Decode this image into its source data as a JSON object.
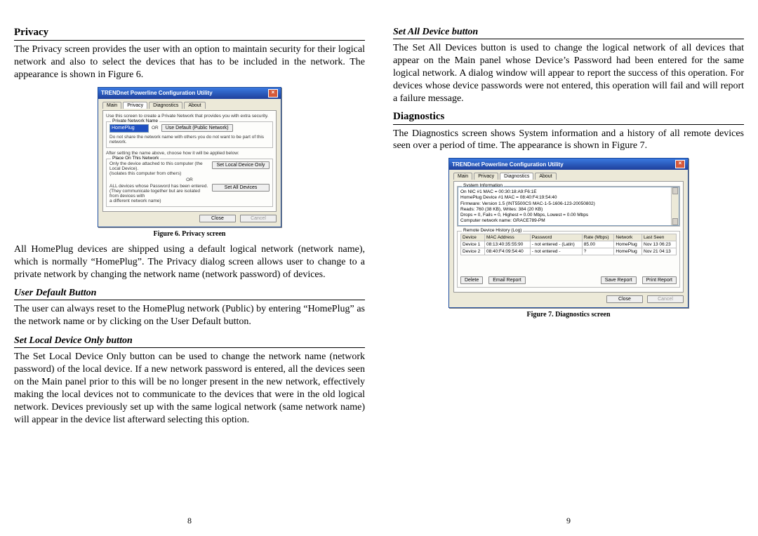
{
  "left": {
    "section_privacy_title": "Privacy",
    "privacy_p1": "The Privacy screen provides the user with an option to maintain security for their logical network and also to select the devices that has to be included in the network. The appearance is shown in Figure 6.",
    "fig6_caption": "Figure 6. Privacy screen",
    "privacy_p2": "All HomePlug devices are shipped using a default logical network (network name), which is normally “HomePlug”. The Privacy dialog screen allows user to change to a private network by changing the network name (network password) of devices.",
    "sub_user_default": "User Default Button",
    "user_default_p": "The user can always reset to the HomePlug network (Public) by entering “HomePlug” as the network name or by clicking on the User Default button.",
    "sub_set_local": "Set Local Device Only button",
    "set_local_p": "The Set Local Device Only button can be used to change the network name (network password) of the local device. If a new network password is entered, all the devices seen on the Main panel prior to this will be no longer present in the new network, effectively making the local devices not to communicate to the devices that were in the old logical network. Devices previously set up with the same logical network (same network name) will appear in the device list afterward selecting this option.",
    "page_number": "8"
  },
  "right": {
    "sub_set_all": "Set All Device button",
    "set_all_p": "The Set All Devices button is used to change the logical network of all devices that appear on the Main panel whose Device’s Password had been entered for the same logical network. A dialog window will appear to report the success of this operation. For devices whose device passwords were not entered, this operation will fail and will report a failure message.",
    "section_diag_title": "Diagnostics",
    "diag_p": "The Diagnostics screen shows System information and a history of all remote devices seen over a period of time. The appearance is shown in Figure 7.",
    "fig7_caption": "Figure 7. Diagnostics screen",
    "page_number": "9"
  },
  "privacy_window": {
    "title": "TRENDnet Powerline Configuration Utility",
    "tabs": [
      "Main",
      "Privacy",
      "Diagnostics",
      "About"
    ],
    "active_tab_index": 1,
    "intro": "Use this screen to create a Private Network that provides you with extra security.",
    "network_label": "Private Network Name",
    "network_value": "HomePlug",
    "or": "OR",
    "use_default_btn": "Use Default (Public Network)",
    "note1": "Do not share the network name with others you do not want to be part of this network.",
    "note2": "After setting the name above, choose how it will be applied below:",
    "fieldset_legend": "Place On This Network",
    "only_text": "Only the device attached to this computer (the Local Device).\n(Isolates this computer from others)",
    "set_local_btn": "Set Local Device Only",
    "all_text": "ALL devices whose Password has been entered.\n(They communicate together but are isolated from devices with\na different network name)",
    "set_all_btn": "Set All Devices",
    "close_btn": "Close",
    "cancel_btn": "Cancel"
  },
  "diag_window": {
    "title": "TRENDnet Powerline Configuration Utility",
    "tabs": [
      "Main",
      "Privacy",
      "Diagnostics",
      "About"
    ],
    "active_tab_index": 2,
    "sysinfo_legend": "System Information",
    "sysinfo_lines": [
      "On NIC #1 MAC = 00:30:18:A9:F6:1E",
      "HomePlug Device #1 MAC = 08:40:F4:19:54:40",
      "Firmware: Version 1.5  (INT5500CS MAC-1-5-1606-123-20050802)",
      "Reads: 760 (38 KB), Writes: 384 (20 KB)",
      "Drops = 0, Fails = 0, Highest = 0.00 Mbps, Lowest = 0.00 Mbps",
      "",
      "Computer network name: GRACE789-PM"
    ],
    "history_legend": "Remote Device History (Log)",
    "columns": [
      "Device",
      "MAC Address",
      "Password",
      "Rate (Mbps)",
      "Network",
      "Last Seen"
    ],
    "rows": [
      [
        "Device 1",
        "08:13:40:35:55:90",
        "- not entered - (Latin)",
        "85.00",
        "HomePlug",
        "Nov 13 06:23"
      ],
      [
        "Device 2",
        "08:40:F4:09:54:40",
        "- not entered -",
        "?",
        "HomePlug",
        "Nov 21 04:13"
      ]
    ],
    "btn_delete": "Delete",
    "btn_email": "Email Report",
    "btn_save": "Save Report",
    "btn_print": "Print Report",
    "close_btn": "Close",
    "cancel_btn": "Cancel"
  }
}
